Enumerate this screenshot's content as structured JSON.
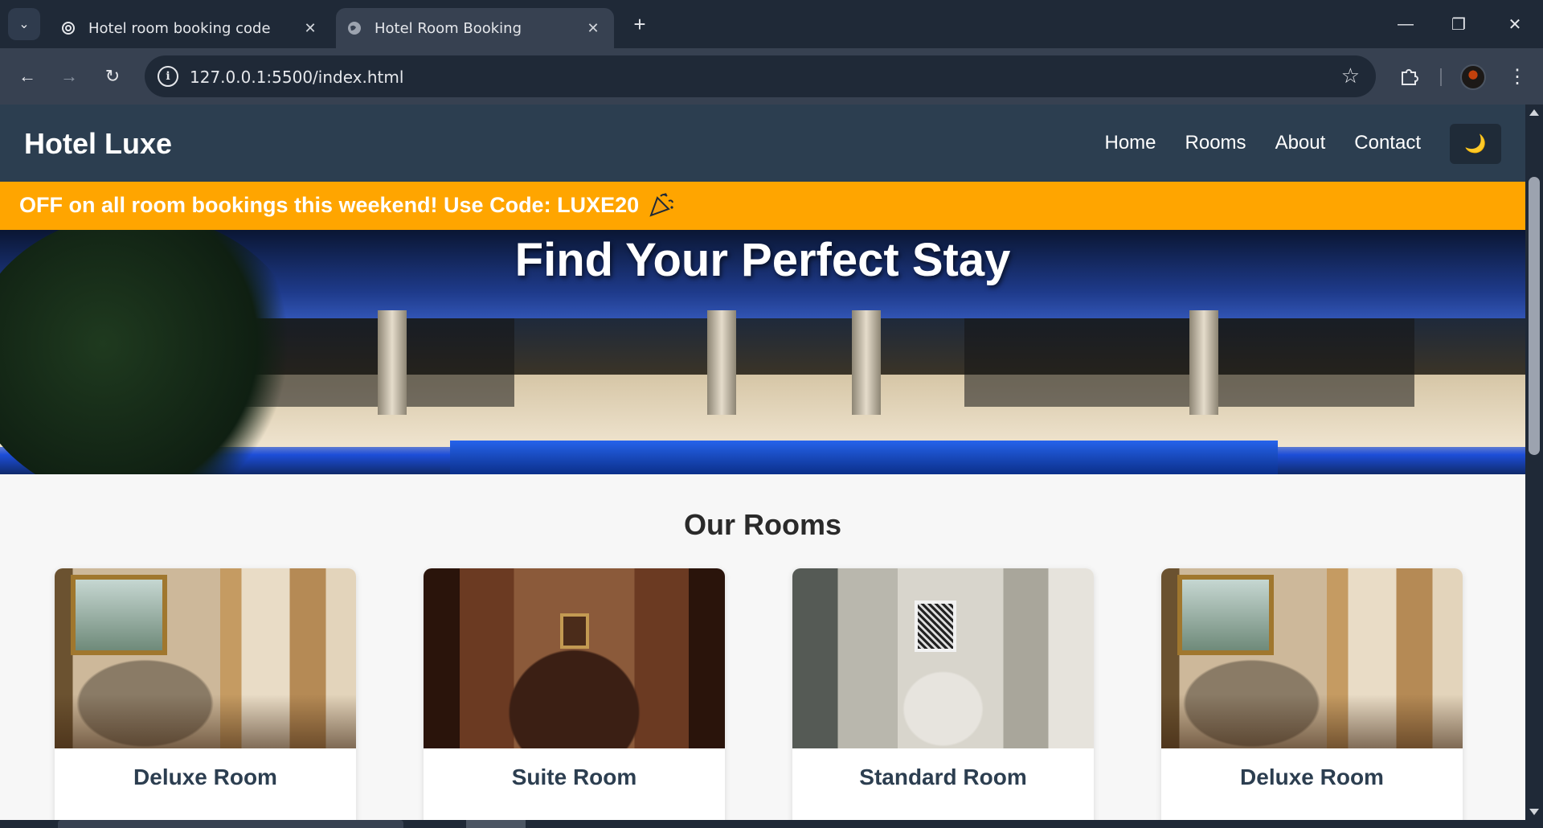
{
  "browser": {
    "tabs": [
      {
        "title": "Hotel room booking code",
        "active": false,
        "icon": "chatgpt-icon"
      },
      {
        "title": "Hotel Room Booking",
        "active": true,
        "icon": "globe-icon"
      }
    ],
    "url": "127.0.0.1:5500/index.html"
  },
  "site": {
    "brand": "Hotel Luxe",
    "nav": [
      "Home",
      "Rooms",
      "About",
      "Contact"
    ],
    "theme_toggle_icon": "🌙",
    "promo": "OFF on all room bookings this weekend! Use Code: LUXE20",
    "hero_title": "Find Your Perfect Stay",
    "section_title": "Our Rooms",
    "rooms": [
      {
        "name": "Deluxe Room",
        "image": "deluxe"
      },
      {
        "name": "Suite Room",
        "image": "suite"
      },
      {
        "name": "Standard Room",
        "image": "standard"
      },
      {
        "name": "Deluxe Room",
        "image": "deluxe"
      }
    ]
  },
  "colors": {
    "header": "#2c3e50",
    "promo": "#ffa500",
    "room_title": "#2c3e50",
    "browser_dark": "#1f2937"
  }
}
